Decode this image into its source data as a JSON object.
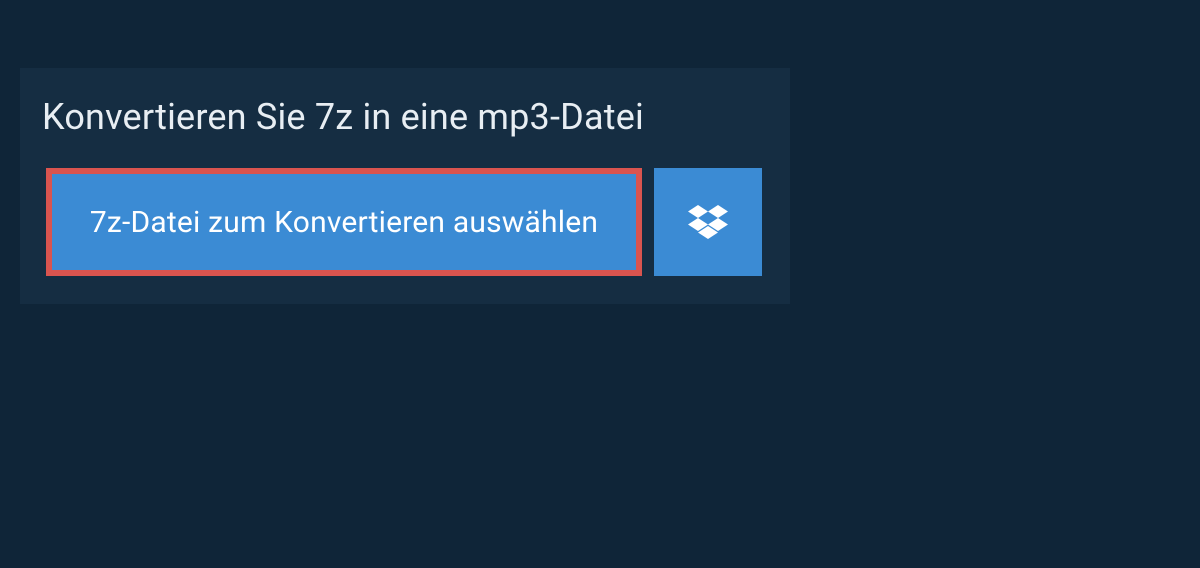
{
  "title": "Konvertieren Sie 7z in eine mp3-Datei",
  "select_button_label": "7z-Datei zum Konvertieren auswählen",
  "icons": {
    "dropbox": "dropbox-icon"
  },
  "colors": {
    "background": "#0f2538",
    "panel": "#152d42",
    "button": "#3b8bd4",
    "highlight_border": "#d9544f"
  }
}
